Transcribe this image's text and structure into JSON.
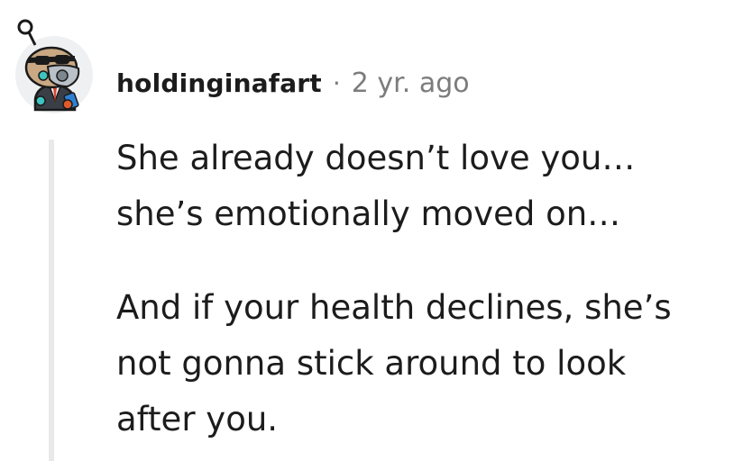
{
  "comment": {
    "avatar_icon": "snoo-avatar-icon",
    "username": "holdinginafart",
    "separator": "·",
    "age": "2 yr. ago",
    "paragraphs": [
      [
        "She already doesn’t love you…",
        "she’s emotionally moved on…"
      ],
      [
        "And if your health declines, she’s",
        "not gonna stick around to look",
        "after you."
      ]
    ]
  },
  "colors": {
    "thread_line": "#e9e9e9",
    "meta_text": "#7c7c7c",
    "body_text": "#1c1c1c"
  }
}
